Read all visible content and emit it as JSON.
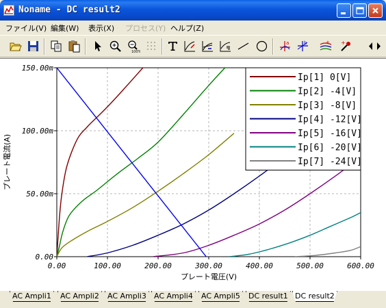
{
  "window": {
    "title": "Noname - DC result2",
    "icon": "app-graph-icon"
  },
  "menu": [
    {
      "label": "ファイル(V)",
      "enabled": true
    },
    {
      "label": "編集(W)",
      "enabled": true
    },
    {
      "label": "表示(X)",
      "enabled": true
    },
    {
      "label": "プロセス(Y)",
      "enabled": false
    },
    {
      "label": "ヘルプ(Z)",
      "enabled": true
    }
  ],
  "toolbar": [
    "open-folder-icon",
    "save-icon",
    "copy-icon",
    "paste-icon",
    "pointer-icon",
    "zoom-in-icon",
    "zoom-100-icon",
    "grid-icon",
    "text-icon",
    "draw-curve-icon",
    "draw-curve-2-icon",
    "draw-curve-3-icon",
    "line-icon",
    "circle-icon",
    "marker-a-icon",
    "marker-b-icon",
    "multi-curve-icon",
    "dropper-icon",
    "scroll-arrows-icon"
  ],
  "chart_data": {
    "type": "line",
    "xlabel": "プレート電圧(V)",
    "ylabel": "プレート電流(A)",
    "xlim": [
      0,
      600
    ],
    "ylim": [
      0,
      0.15
    ],
    "x_ticks": [
      "0.00",
      "100.00",
      "200.00",
      "300.00",
      "400.00",
      "500.00",
      "600.00"
    ],
    "y_ticks": [
      "0.00",
      "50.00m",
      "100.00m",
      "150.00m"
    ],
    "grid": true,
    "legend_position": "top-right",
    "series": [
      {
        "name": "Ip[1]  0[V]",
        "color": "#800000",
        "points": [
          [
            0,
            0
          ],
          [
            5,
            0.03
          ],
          [
            10,
            0.05
          ],
          [
            20,
            0.072
          ],
          [
            40,
            0.093
          ],
          [
            60,
            0.103
          ],
          [
            80,
            0.111
          ],
          [
            100,
            0.119
          ],
          [
            130,
            0.132
          ],
          [
            170,
            0.15
          ]
        ]
      },
      {
        "name": "Ip[2]  -4[V]",
        "color": "#008000",
        "points": [
          [
            0,
            0
          ],
          [
            5,
            0.008
          ],
          [
            12,
            0.02
          ],
          [
            25,
            0.033
          ],
          [
            50,
            0.044
          ],
          [
            80,
            0.053
          ],
          [
            120,
            0.066
          ],
          [
            160,
            0.078
          ],
          [
            200,
            0.091
          ],
          [
            250,
            0.113
          ],
          [
            300,
            0.136
          ],
          [
            332,
            0.15
          ]
        ]
      },
      {
        "name": "Ip[3]  -8[V]",
        "color": "#808000",
        "points": [
          [
            0,
            0
          ],
          [
            10,
            0.007
          ],
          [
            30,
            0.013
          ],
          [
            60,
            0.02
          ],
          [
            100,
            0.028
          ],
          [
            150,
            0.039
          ],
          [
            200,
            0.052
          ],
          [
            250,
            0.066
          ],
          [
            300,
            0.081
          ],
          [
            350,
            0.098
          ]
        ]
      },
      {
        "name": "Ip[4]  -12[V]",
        "color": "#000080",
        "points": [
          [
            60,
            0
          ],
          [
            100,
            0.003
          ],
          [
            150,
            0.009
          ],
          [
            200,
            0.017
          ],
          [
            250,
            0.026
          ],
          [
            300,
            0.037
          ],
          [
            350,
            0.05
          ],
          [
            400,
            0.064
          ],
          [
            420,
            0.07
          ]
        ]
      },
      {
        "name": "Ip[5]  -16[V]",
        "color": "#800080",
        "points": [
          [
            190,
            0
          ],
          [
            250,
            0.003
          ],
          [
            300,
            0.009
          ],
          [
            350,
            0.017
          ],
          [
            400,
            0.026
          ],
          [
            450,
            0.037
          ],
          [
            500,
            0.05
          ],
          [
            550,
            0.064
          ],
          [
            590,
            0.076
          ]
        ]
      },
      {
        "name": "Ip[6]  -20[V]",
        "color": "#008080",
        "points": [
          [
            340,
            0
          ],
          [
            380,
            0.002
          ],
          [
            420,
            0.006
          ],
          [
            460,
            0.011
          ],
          [
            500,
            0.017
          ],
          [
            540,
            0.024
          ],
          [
            580,
            0.031
          ],
          [
            600,
            0.035
          ]
        ]
      },
      {
        "name": "Ip[7]  -24[V]",
        "color": "#808080",
        "points": [
          [
            470,
            0
          ],
          [
            510,
            0.001
          ],
          [
            550,
            0.003
          ],
          [
            580,
            0.005
          ],
          [
            600,
            0.008
          ]
        ]
      }
    ],
    "load_line": {
      "color": "#0000ff",
      "points": [
        [
          0,
          0.15
        ],
        [
          295,
          0
        ]
      ]
    }
  },
  "tabs": [
    {
      "label": "AC Ampli1",
      "active": false
    },
    {
      "label": "AC Ampli2",
      "active": false
    },
    {
      "label": "AC Ampli3",
      "active": false
    },
    {
      "label": "AC Ampli4",
      "active": false
    },
    {
      "label": "AC Ampli5",
      "active": false
    },
    {
      "label": "DC result1",
      "active": false
    },
    {
      "label": "DC result2",
      "active": true
    }
  ]
}
